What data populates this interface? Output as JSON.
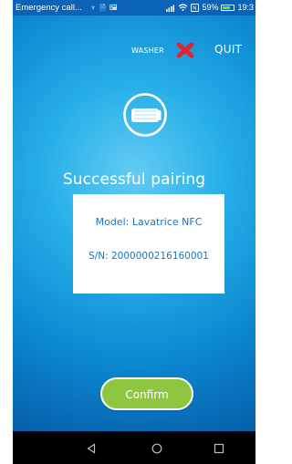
{
  "status_bar": {
    "notification_text": "Emergency call...",
    "mini_icons_text": "♆ 🗎 🖼",
    "battery_text": "59%",
    "time_text": "19:3"
  },
  "header": {
    "washer_label": "WASHER",
    "quit_label": "QUIT"
  },
  "main": {
    "title": "Successful pairing",
    "model_text": "Model: Lavatrice NFC",
    "serial_text": "S/N: 2000000216160001",
    "confirm_label": "Confirm"
  },
  "icons": {
    "status_icons": [
      "signal-icon",
      "wifi-icon",
      "nfc-icon",
      "battery-icon"
    ],
    "close": "close-icon",
    "washer": "washer-icon",
    "navigation": [
      "back-icon",
      "home-icon",
      "recents-icon"
    ]
  },
  "colors": {
    "accent_blue": "#1B73C0",
    "confirm_green": "#8EC73F",
    "close_red": "#E5232E"
  },
  "status": {
    "battery_level_percent": 59
  }
}
